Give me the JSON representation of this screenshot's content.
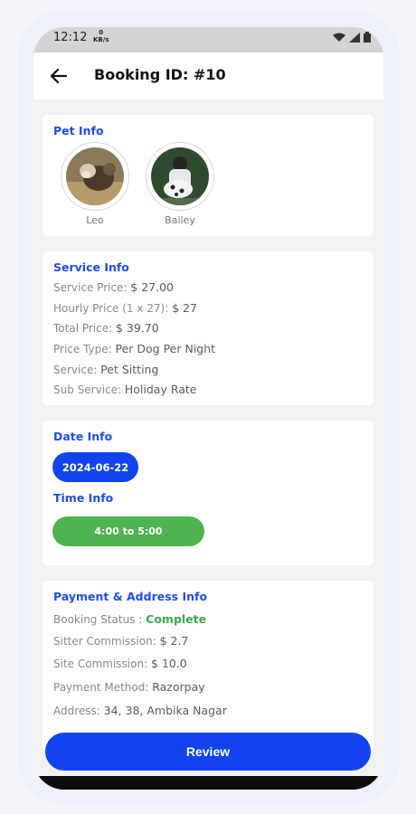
{
  "status_bar": {
    "time": "12:12",
    "speed_value": "0",
    "speed_unit": "KB/s"
  },
  "header": {
    "title": "Booking ID: #10"
  },
  "pet_info": {
    "title": "Pet Info",
    "pets": [
      {
        "name": "Leo"
      },
      {
        "name": "Bailey"
      }
    ]
  },
  "service_info": {
    "title": "Service Info",
    "rows": [
      {
        "label": "Service Price: ",
        "value": "$ 27.00"
      },
      {
        "label": "Hourly Price (1 x 27): ",
        "value": "$ 27"
      },
      {
        "label": "Total Price: ",
        "value": "$ 39.70"
      },
      {
        "label": "Price Type: ",
        "value": "Per Dog Per Night"
      },
      {
        "label": "Service: ",
        "value": "Pet Sitting"
      },
      {
        "label": "Sub Service: ",
        "value": "Holiday Rate"
      }
    ]
  },
  "date_info": {
    "title": "Date Info",
    "date": "2024-06-22",
    "time_title": "Time Info",
    "time_slot": "4:00 to 5:00"
  },
  "payment_info": {
    "title": "Payment & Address Info",
    "rows": [
      {
        "label": "Booking Status : ",
        "value": "Complete"
      },
      {
        "label": "Sitter Commission: ",
        "value": "$ 2.7"
      },
      {
        "label": "Site Commission: ",
        "value": "$ 10.0"
      },
      {
        "label": "Payment Method: ",
        "value": "Razorpay"
      },
      {
        "label": "Address: ",
        "value": "34, 38, Ambika Nagar"
      }
    ]
  },
  "footer": {
    "review_label": "Review"
  },
  "colors": {
    "primary": "#1144ee",
    "section_title": "#1e4ee8",
    "success": "#4fb34f",
    "background": "#f2f2f2"
  }
}
